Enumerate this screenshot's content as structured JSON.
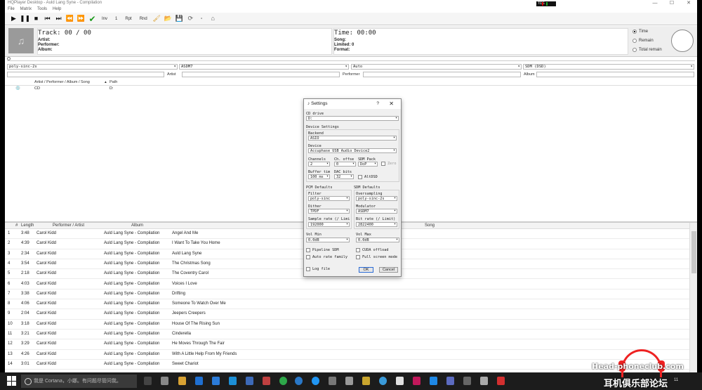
{
  "window": {
    "title": "HQPlayer Desktop - Auld Lang Syne - Compilation",
    "menu": [
      "File",
      "Matrix",
      "Tools",
      "Help"
    ]
  },
  "toolbar": {
    "inv_label": "Inv",
    "one_label": "1",
    "rpt_label": "Rpt",
    "rnd_label": "Rnd"
  },
  "info": {
    "track_text": "Track: 00 / 00",
    "artist_label": "Artist:",
    "performer_label": "Performer:",
    "album_label": "Album:",
    "time_text": "Time: 00:00",
    "song_label": "Song:",
    "limited_text": "Limited: 0",
    "format_label": "Format:",
    "time_modes": [
      "Time",
      "Remain",
      "Total remain"
    ],
    "time_mode_selected": "Time"
  },
  "filters": {
    "filter_value": "poly-sinc-2s",
    "modulator_value": "ASDM7",
    "rate_value": "Auto",
    "sdm_value": "SDM (DSD)",
    "artist_label": "Artist",
    "performer_label": "Performer",
    "album_label": "Album"
  },
  "library": {
    "col_artist": "Artist / Performer / Album / Song",
    "col_path": "Path",
    "rows": [
      {
        "name": "CD",
        "path": "D:"
      }
    ]
  },
  "tracks": {
    "headers": {
      "num": "#",
      "length": "Length",
      "performer": "Performer / Artist",
      "album": "Album",
      "song": "Song"
    },
    "rows": [
      {
        "num": "1",
        "length": "3:48",
        "performer": "Carol Kidd",
        "album": "Auld Lang Syne - Compilation",
        "song": "Angel And Me"
      },
      {
        "num": "2",
        "length": "4:39",
        "performer": "Carol Kidd",
        "album": "Auld Lang Syne - Compilation",
        "song": "I Want To Take You Home"
      },
      {
        "num": "3",
        "length": "2:34",
        "performer": "Carol Kidd",
        "album": "Auld Lang Syne - Compilation",
        "song": "Auld Lang Syne"
      },
      {
        "num": "4",
        "length": "3:54",
        "performer": "Carol Kidd",
        "album": "Auld Lang Syne - Compilation",
        "song": "The Christmas Song"
      },
      {
        "num": "5",
        "length": "2:18",
        "performer": "Carol Kidd",
        "album": "Auld Lang Syne - Compilation",
        "song": "The Coventry Carol"
      },
      {
        "num": "6",
        "length": "4:03",
        "performer": "Carol Kidd",
        "album": "Auld Lang Syne - Compilation",
        "song": "Voices I Love"
      },
      {
        "num": "7",
        "length": "3:38",
        "performer": "Carol Kidd",
        "album": "Auld Lang Syne - Compilation",
        "song": "Drifting"
      },
      {
        "num": "8",
        "length": "4:06",
        "performer": "Carol Kidd",
        "album": "Auld Lang Syne - Compilation",
        "song": "Someone To Watch Over Me"
      },
      {
        "num": "9",
        "length": "2:04",
        "performer": "Carol Kidd",
        "album": "Auld Lang Syne - Compilation",
        "song": "Jeepers Creepers"
      },
      {
        "num": "10",
        "length": "3:18",
        "performer": "Carol Kidd",
        "album": "Auld Lang Syne - Compilation",
        "song": "House Of The Rising Sun"
      },
      {
        "num": "11",
        "length": "3:21",
        "performer": "Carol Kidd",
        "album": "Auld Lang Syne - Compilation",
        "song": "Cinderella"
      },
      {
        "num": "12",
        "length": "3:29",
        "performer": "Carol Kidd",
        "album": "Auld Lang Syne - Compilation",
        "song": "He Moves Through The Fair"
      },
      {
        "num": "13",
        "length": "4:26",
        "performer": "Carol Kidd",
        "album": "Auld Lang Syne - Compilation",
        "song": "With A Little Help From My Friends"
      },
      {
        "num": "14",
        "length": "3:01",
        "performer": "Carol Kidd",
        "album": "Auld Lang Syne - Compilation",
        "song": "Sweet Chariot"
      }
    ]
  },
  "settings": {
    "title": "Settings",
    "help": "?",
    "close": "✕",
    "cd_drive_label": "CD drive",
    "cd_drive_value": "D:",
    "device_settings_label": "Device Settings",
    "backend_label": "Backend",
    "backend_value": "ASIO",
    "device_label": "Device",
    "device_value": "Accuphase USB Audio Device2",
    "channels_label": "Channels",
    "channels_value": "2",
    "ch_offset_label": "Ch. offse",
    "ch_offset_value": "0",
    "sdm_pack_label": "SDM Pack",
    "sdm_pack_value": "DoP",
    "zero_label": "Zero",
    "buffer_label": "Buffer tim",
    "buffer_value": "100 ms",
    "dac_bits_label": "DAC bits",
    "dac_bits_value": "32",
    "altdsd_label": "AltDSD",
    "pcm_defaults_label": "PCM Defaults",
    "sdm_defaults_label": "SDM Defaults",
    "filter_label": "Filter",
    "filter_value": "poly-sinc",
    "oversampling_label": "Oversampling",
    "oversampling_value": "poly-sinc-2s",
    "dither_label": "Dither",
    "dither_value": "TPDF",
    "modulator_label": "Modulator",
    "modulator_value": "ASDM7",
    "sample_rate_label": "Sample rate (/ Limi",
    "sample_rate_value": "192000",
    "bit_rate_label": "Bit rate (/ Limit)",
    "bit_rate_value": "2822400",
    "vol_min_label": "Vol Min",
    "vol_min_value": "0.0dB",
    "vol_max_label": "Vol Max",
    "vol_max_value": "0.0dB",
    "pipeline_sdm_label": "Pipeline SDM",
    "cuda_label": "CUDA offload",
    "auto_rate_label": "Auto rate family",
    "full_screen_label": "Full screen mode",
    "log_file_label": "Log file",
    "ok_label": "OK",
    "cancel_label": "Cancel"
  },
  "taskbar": {
    "search_placeholder": "我是 Cortana，小娜。有问题尽管问我。",
    "clock": "11"
  },
  "watermark": {
    "text_en": "Head-phoneclub.com",
    "text_cn": "耳机俱乐部论坛"
  }
}
